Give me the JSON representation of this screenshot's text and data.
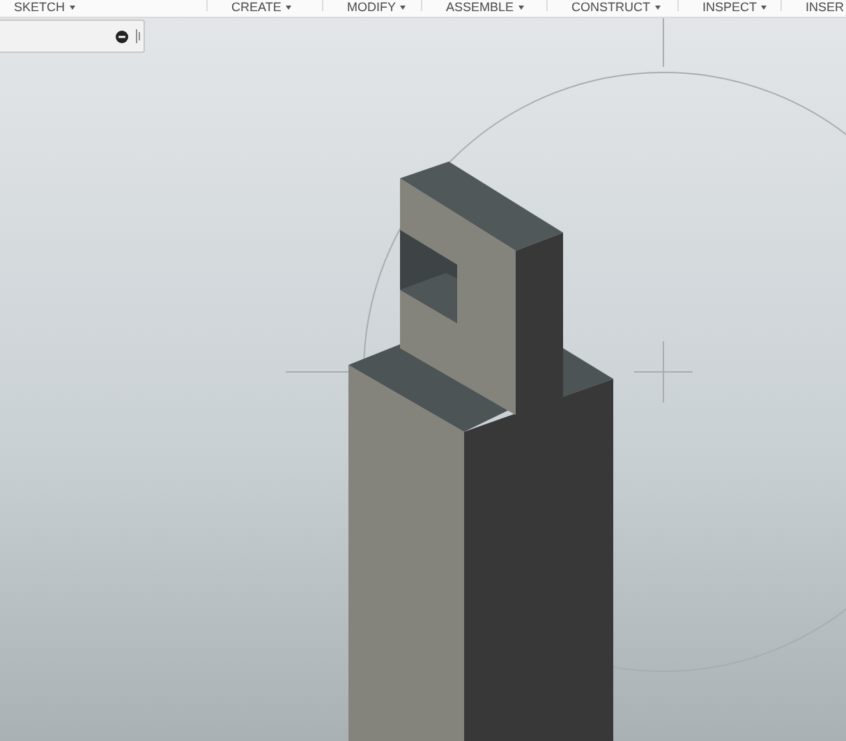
{
  "toolbar": {
    "menus": [
      {
        "label": "SKETCH"
      },
      {
        "label": "CREATE"
      },
      {
        "label": "MODIFY"
      },
      {
        "label": "ASSEMBLE"
      },
      {
        "label": "CONSTRUCT"
      },
      {
        "label": "INSPECT"
      },
      {
        "label": "INSER"
      }
    ]
  }
}
